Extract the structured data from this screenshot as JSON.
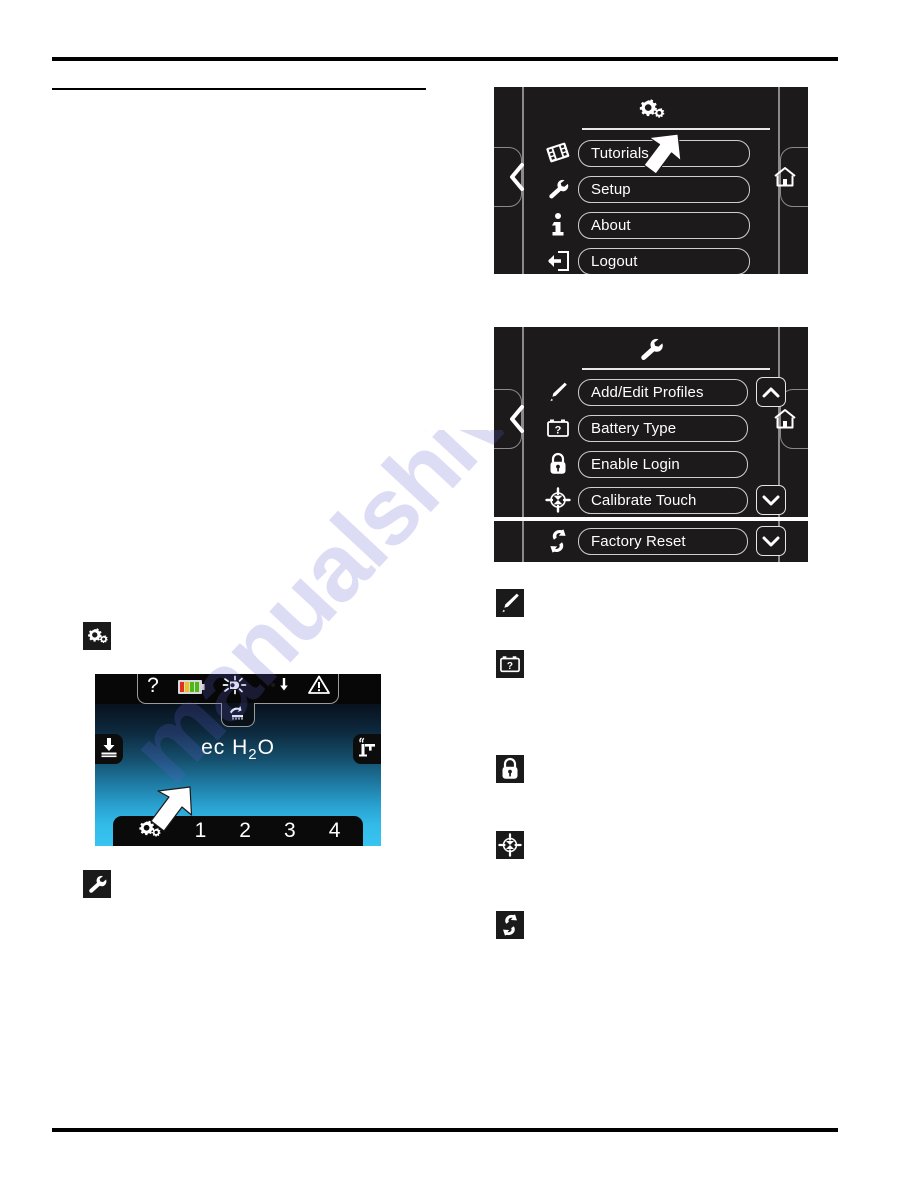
{
  "document": {
    "type": "equipment-operator-manual-page",
    "watermark": "manualshive"
  },
  "panels": [
    {
      "id": "settings-menu",
      "title_icon": "gears-icon",
      "nav_back": "back-chevron-icon",
      "nav_home": "home-icon",
      "rows": [
        {
          "icon": "film-strip-icon",
          "label": "Tutorials"
        },
        {
          "icon": "wrench-icon",
          "label": "Setup"
        },
        {
          "icon": "info-icon",
          "label": "About"
        },
        {
          "icon": "logout-arrow-icon",
          "label": "Logout"
        }
      ]
    },
    {
      "id": "setup-menu",
      "title_icon": "wrench-icon",
      "nav_back": "back-chevron-icon",
      "nav_home": "home-icon",
      "rows": [
        {
          "icon": "pencil-icon",
          "label": "Add/Edit Profiles",
          "scroll": "chevron-up-icon"
        },
        {
          "icon": "battery-question-icon",
          "label": "Battery Type",
          "scroll": ""
        },
        {
          "icon": "lock-icon",
          "label": "Enable Login",
          "scroll": ""
        },
        {
          "icon": "crosshair-icon",
          "label": "Calibrate Touch",
          "scroll": "chevron-down-icon"
        }
      ],
      "extra_strip": {
        "icon": "reset-arrows-icon",
        "label": "Factory Reset",
        "scroll": "chevron-down-icon"
      }
    }
  ],
  "legend_icons_left": [
    {
      "name": "gears-icon"
    },
    {
      "name": "wrench-icon"
    }
  ],
  "legend_icons_right": [
    {
      "name": "pencil-icon"
    },
    {
      "name": "battery-question-icon"
    },
    {
      "name": "lock-icon"
    },
    {
      "name": "crosshair-icon"
    },
    {
      "name": "reset-arrows-icon"
    }
  ],
  "machine_display": {
    "status_icons": [
      "help-question-icon",
      "battery-gauge-icon",
      "headlight-icon",
      "hourmeter-icon",
      "warning-triangle-icon"
    ],
    "tab_icon": "brush-speed-icon",
    "left_icon": "down-pressure-icon",
    "right_icon": "faucet-icon",
    "logo_prefix": "ec H",
    "logo_sub": "2",
    "logo_suffix": "O",
    "bottom_bar": {
      "settings_icon": "gears-icon",
      "zones": [
        "1",
        "2",
        "3",
        "4"
      ]
    },
    "pointer": "white-arrow-pointer"
  },
  "colors": {
    "panel_bg": "#1c1a1a",
    "panel_border": "#8a8a8a",
    "button_border": "#cfcfcf",
    "text": "#ffffff",
    "screen_cyan": "#38c4f0",
    "screen_dark": "#050811",
    "battery_red": "#e03020",
    "battery_yellow": "#f0c01a",
    "battery_green": "#4db818",
    "watermark": "#6060d2"
  }
}
